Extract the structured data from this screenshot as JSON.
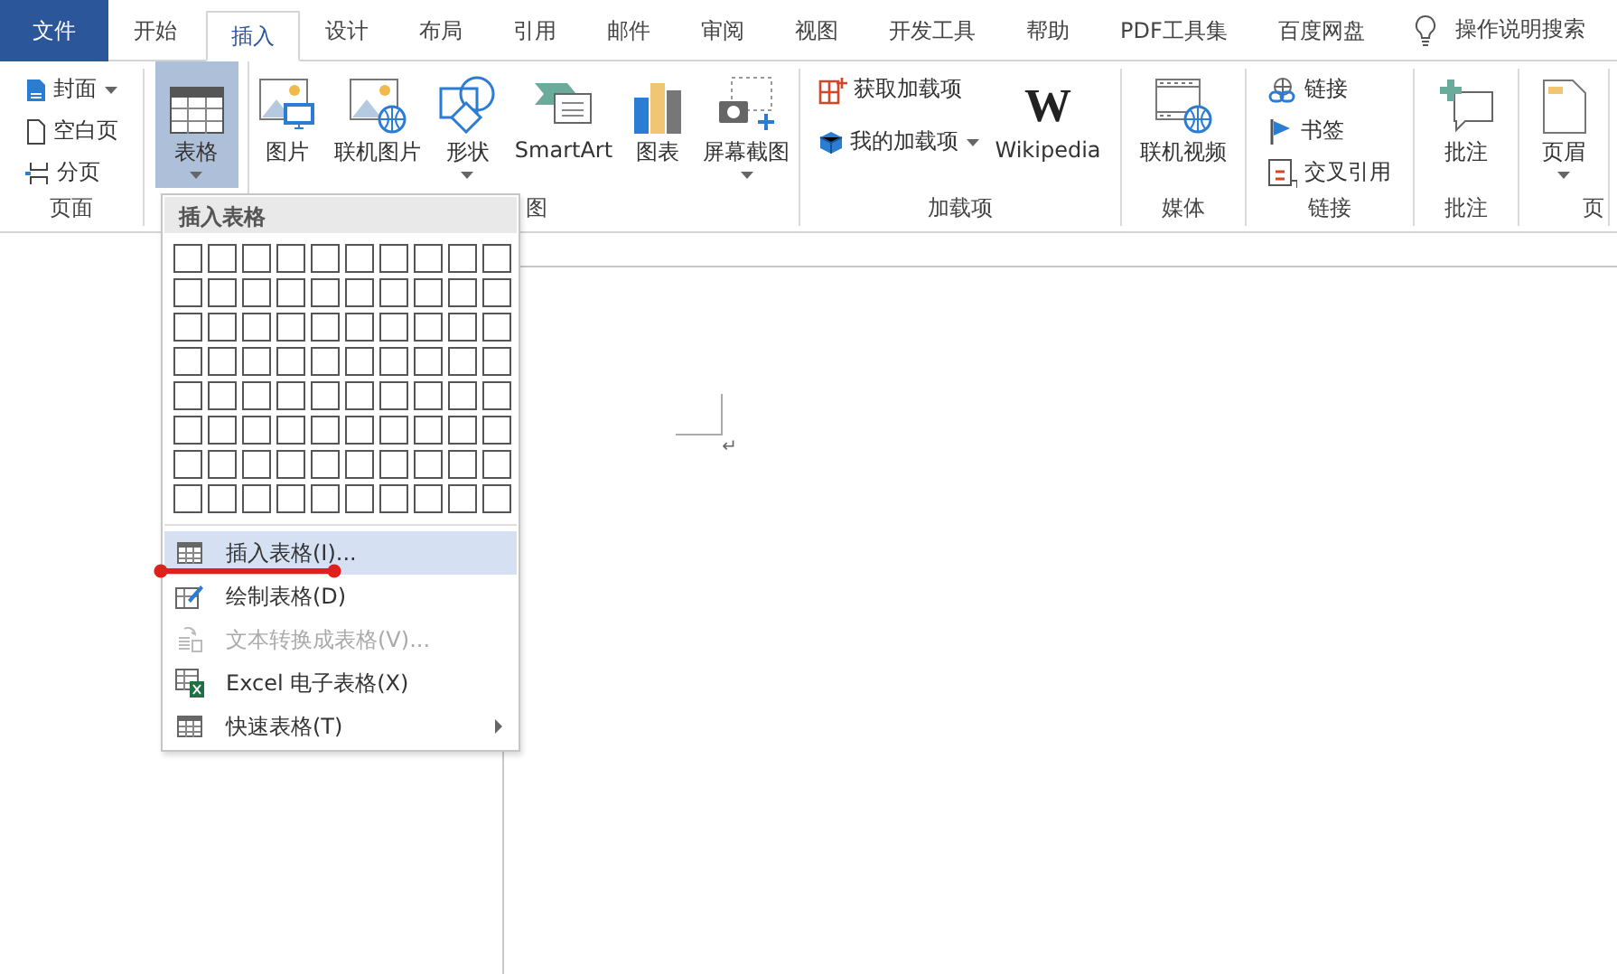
{
  "tabs": [
    {
      "label": "文件",
      "kind": "file",
      "selected": false
    },
    {
      "label": "开始",
      "kind": "tab",
      "selected": false
    },
    {
      "label": "插入",
      "kind": "tab",
      "selected": true
    },
    {
      "label": "设计",
      "kind": "tab",
      "selected": false
    },
    {
      "label": "布局",
      "kind": "tab",
      "selected": false
    },
    {
      "label": "引用",
      "kind": "tab",
      "selected": false
    },
    {
      "label": "邮件",
      "kind": "tab",
      "selected": false
    },
    {
      "label": "审阅",
      "kind": "tab",
      "selected": false
    },
    {
      "label": "视图",
      "kind": "tab",
      "selected": false
    },
    {
      "label": "开发工具",
      "kind": "tab",
      "selected": false
    },
    {
      "label": "帮助",
      "kind": "tab",
      "selected": false
    },
    {
      "label": "PDF工具集",
      "kind": "tab",
      "selected": false
    },
    {
      "label": "百度网盘",
      "kind": "tab",
      "selected": false
    }
  ],
  "search": {
    "label": "操作说明搜索"
  },
  "ribbon": {
    "groups": [
      {
        "label": "页面",
        "items": [
          {
            "label": "封面",
            "kind": "small",
            "dropdown": true,
            "pressed": false
          },
          {
            "label": "空白页",
            "kind": "small",
            "dropdown": false,
            "pressed": false
          },
          {
            "label": "分页",
            "kind": "small",
            "dropdown": false,
            "pressed": false
          }
        ]
      },
      {
        "items": [
          {
            "label": "表格",
            "kind": "large",
            "dropdown": true,
            "pressed": true
          }
        ]
      },
      {
        "label": "图",
        "items": [
          {
            "label": "图片",
            "kind": "large",
            "dropdown": false,
            "pressed": false
          },
          {
            "label": "联机图片",
            "kind": "large",
            "dropdown": false,
            "pressed": false
          },
          {
            "label": "形状",
            "kind": "large",
            "dropdown": true,
            "pressed": false
          },
          {
            "label": "SmartArt",
            "kind": "large",
            "dropdown": false,
            "pressed": false
          },
          {
            "label": "图表",
            "kind": "large",
            "dropdown": false,
            "pressed": false
          },
          {
            "label": "屏幕截图",
            "kind": "large",
            "dropdown": true,
            "pressed": false
          }
        ]
      },
      {
        "label": "加载项",
        "items": [
          {
            "label": "获取加载项",
            "kind": "small",
            "dropdown": false,
            "pressed": false
          },
          {
            "label": "我的加载项",
            "kind": "small",
            "dropdown": true,
            "pressed": false
          },
          {
            "label": "Wikipedia",
            "kind": "large",
            "logo": "W",
            "dropdown": false,
            "pressed": false
          }
        ]
      },
      {
        "label": "媒体",
        "items": [
          {
            "label": "联机视频",
            "kind": "large",
            "dropdown": false,
            "pressed": false
          }
        ]
      },
      {
        "label": "链接",
        "items": [
          {
            "label": "链接",
            "kind": "small",
            "dropdown": false,
            "pressed": false
          },
          {
            "label": "书签",
            "kind": "small",
            "dropdown": false,
            "pressed": false
          },
          {
            "label": "交叉引用",
            "kind": "small",
            "dropdown": false,
            "pressed": false
          }
        ]
      },
      {
        "label": "批注",
        "items": [
          {
            "label": "批注",
            "kind": "large",
            "dropdown": false,
            "pressed": false
          }
        ]
      },
      {
        "label": "页",
        "items": [
          {
            "label": "页眉",
            "kind": "large",
            "dropdown": true,
            "pressed": false
          }
        ]
      }
    ]
  },
  "table_menu": {
    "title": "插入表格",
    "items": [
      {
        "label": "插入表格(I)...",
        "selected": true,
        "disabled": false,
        "submenu": false
      },
      {
        "label": "绘制表格(D)",
        "selected": false,
        "disabled": false,
        "submenu": false
      },
      {
        "label": "文本转换成表格(V)...",
        "selected": false,
        "disabled": true,
        "submenu": false
      },
      {
        "label": "Excel 电子表格(X)",
        "selected": false,
        "disabled": false,
        "submenu": false
      },
      {
        "label": "快速表格(T)",
        "selected": false,
        "disabled": false,
        "submenu": true
      }
    ]
  },
  "document": {
    "paragraph_mark": "↵"
  }
}
